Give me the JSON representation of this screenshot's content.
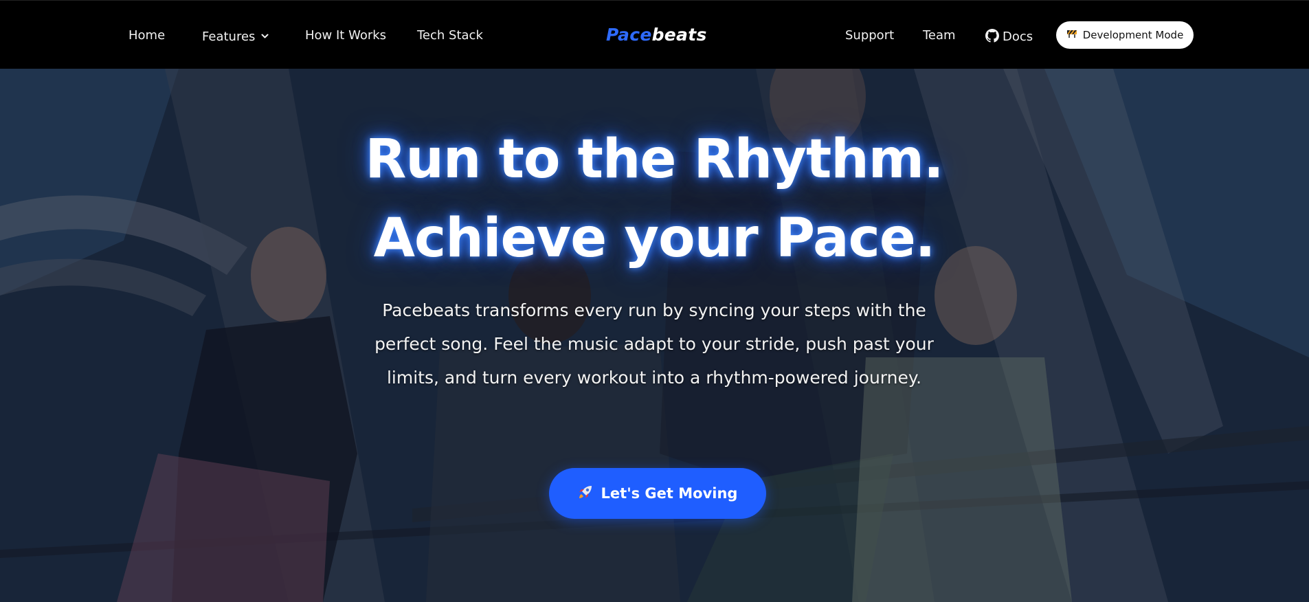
{
  "nav": {
    "left_items": [
      {
        "label": "Home"
      },
      {
        "label": "Features",
        "icon": "chevron-down-icon"
      },
      {
        "label": "How It Works"
      },
      {
        "label": "Tech Stack"
      }
    ],
    "logo": {
      "part1": "Pace",
      "part2": "beats"
    },
    "right_items": [
      {
        "label": "Support"
      },
      {
        "label": "Team"
      },
      {
        "label": "Docs",
        "icon": "github-icon"
      }
    ],
    "dev_button": {
      "label": "Development Mode",
      "icon": "construction-icon"
    }
  },
  "hero": {
    "title_line1": "Run to the Rhythm.",
    "title_line2": "Achieve your Pace.",
    "subtitle": "Pacebeats transforms every run by syncing your steps with the perfect song. Feel the music adapt to your stride, push past your limits, and turn every workout into a rhythm-powered journey.",
    "cta": {
      "label": "Let's Get Moving",
      "icon": "rocket-icon"
    }
  },
  "colors": {
    "accent": "#1f5eff",
    "logo_blue": "#2e6bff",
    "nav_bg": "#000000",
    "text": "#ffffff"
  }
}
